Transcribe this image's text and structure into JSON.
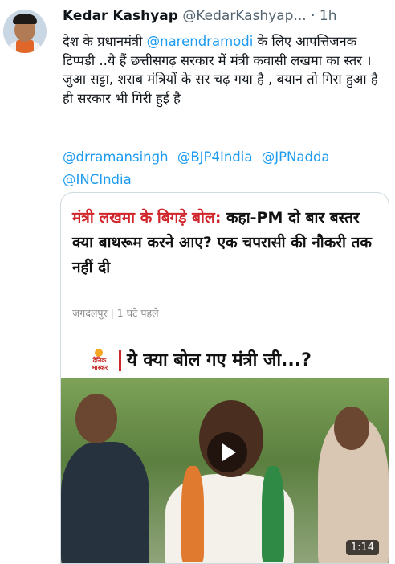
{
  "tweet": {
    "author_name": "Kedar Kashyap",
    "handle": "@KedarKashyap...",
    "separator": "·",
    "time": "1h",
    "text_part1": "देश के प्रधानमंत्री ",
    "mention_in_text": "@narendramodi",
    "text_part2": " के लिए आपत्तिजनक टिप्पड़ी ..ये हैं छत्तीसगढ़ सरकार में मंत्री कवासी लखमा का स्तर । जुआ सट्टा, शराब मंत्रियों के सर चढ़ गया है , बयान तो गिरा हुआ है ही सरकार भी गिरी हुई है",
    "tags": [
      "@drramansingh",
      "@BJP4India",
      "@JPNadda",
      "@INCIndia"
    ]
  },
  "card": {
    "headline_highlight": "मंत्री लखमा के बिगड़े बोल:",
    "headline_rest": " कहा-PM दो बार बस्तर क्या बाथरूम करने आए? एक चपरासी की नौकरी तक नहीं दी",
    "meta": "जगदलपुर | 1 घंटे पहले",
    "video": {
      "logo_text": "दैनिक भास्कर",
      "title": "ये क्या बोल गए मंत्री जी...?",
      "duration": "1:14"
    }
  },
  "colors": {
    "link": "#1d9bf0",
    "headline_red": "#d0262b",
    "muted": "#536471"
  }
}
